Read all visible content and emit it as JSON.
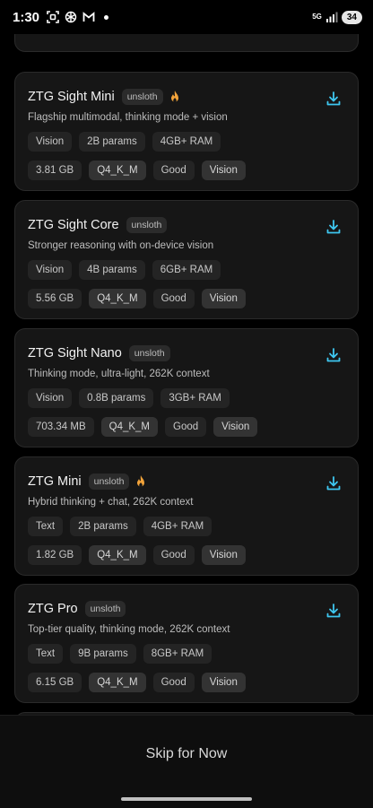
{
  "status": {
    "time": "1:30",
    "network": "5G",
    "battery": "34"
  },
  "colors": {
    "accent": "#3ec7f0",
    "background": "#000000",
    "card": "#161616"
  },
  "models": [
    {
      "name": "ZTG Sight Mini",
      "badge": "unsloth",
      "hot": true,
      "description": "Flagship multimodal, thinking mode + vision",
      "row1": [
        "Vision",
        "2B params",
        "4GB+ RAM"
      ],
      "size": "3.81 GB",
      "quant": "Q4_K_M",
      "quality": "Good",
      "tag": "Vision"
    },
    {
      "name": "ZTG Sight Core",
      "badge": "unsloth",
      "hot": false,
      "description": "Stronger reasoning with on-device vision",
      "row1": [
        "Vision",
        "4B params",
        "6GB+ RAM"
      ],
      "size": "5.56 GB",
      "quant": "Q4_K_M",
      "quality": "Good",
      "tag": "Vision"
    },
    {
      "name": "ZTG Sight Nano",
      "badge": "unsloth",
      "hot": false,
      "description": "Thinking mode, ultra-light, 262K context",
      "row1": [
        "Vision",
        "0.8B params",
        "3GB+ RAM"
      ],
      "size": "703.34 MB",
      "quant": "Q4_K_M",
      "quality": "Good",
      "tag": "Vision"
    },
    {
      "name": "ZTG Mini",
      "badge": "unsloth",
      "hot": true,
      "description": "Hybrid thinking + chat, 262K context",
      "row1": [
        "Text",
        "2B params",
        "4GB+ RAM"
      ],
      "size": "1.82 GB",
      "quant": "Q4_K_M",
      "quality": "Good",
      "tag": "Vision"
    },
    {
      "name": "ZTG Pro",
      "badge": "unsloth",
      "hot": false,
      "description": "Top-tier quality, thinking mode, 262K context",
      "row1": [
        "Text",
        "9B params",
        "8GB+ RAM"
      ],
      "size": "6.15 GB",
      "quant": "Q4_K_M",
      "quality": "Good",
      "tag": "Vision"
    }
  ],
  "footer": {
    "skip_label": "Skip for Now"
  }
}
